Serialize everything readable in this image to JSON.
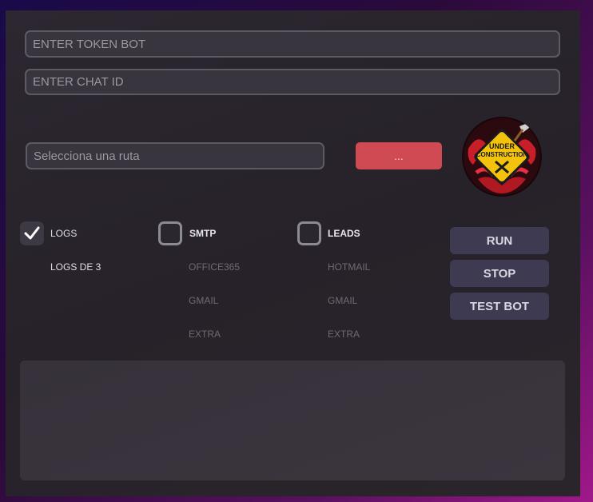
{
  "inputs": {
    "token_placeholder": "ENTER TOKEN BOT",
    "chat_placeholder": "ENTER CHAT ID",
    "route_placeholder": "Selecciona una ruta"
  },
  "browse_label": "...",
  "badge_text": [
    "UNDER",
    "CONSTRUCTION"
  ],
  "checks": {
    "logs": {
      "label": "LOGS",
      "checked": true,
      "sub": [
        "LOGS DE 3"
      ]
    },
    "smtp": {
      "label": "SMTP",
      "checked": false,
      "sub": [
        "OFFICE365",
        "GMAIL",
        "EXTRA"
      ]
    },
    "leads": {
      "label": "LEADS",
      "checked": false,
      "sub": [
        "HOTMAIL",
        "GMAIL",
        "EXTRA"
      ]
    }
  },
  "buttons": {
    "run": "RUN",
    "stop": "STOP",
    "test": "TEST BOT"
  },
  "colors": {
    "accent": "#d04a54",
    "button": "#3e3a52"
  },
  "icons": {
    "check": "check-icon",
    "badge": "under-construction-icon"
  }
}
